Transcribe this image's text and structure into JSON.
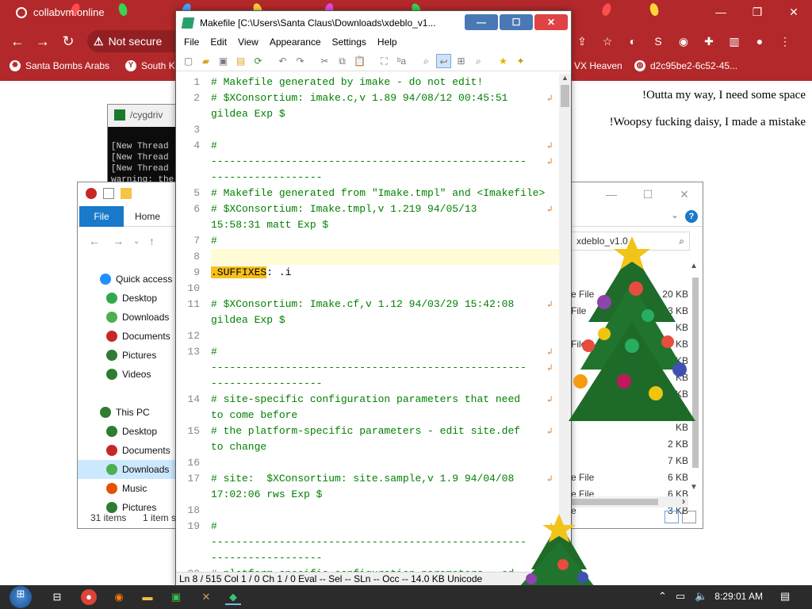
{
  "browser": {
    "tab_title": "collabvm.online",
    "security_label": "Not secure",
    "window_controls": [
      "—",
      "❐",
      "✕"
    ],
    "bookmarks": [
      {
        "icon": "bomb",
        "label": "Santa Bombs Arabs"
      },
      {
        "icon": "Y",
        "label": "South K"
      },
      {
        "icon": "globe",
        "label": "VX Heaven"
      },
      {
        "icon": "globe",
        "label": "d2c95be2-6c52-45..."
      }
    ]
  },
  "page": {
    "lines": [
      "!Outta my way, I need some space",
      "!Woopsy fucking daisy, I made a mistake"
    ]
  },
  "terminal": {
    "title": "/cygdriv",
    "lines": [
      "[New Thread",
      "[New Thread",
      "[New Thread",
      "warning: the"
    ]
  },
  "explorer": {
    "ribbon": {
      "file": "File",
      "home": "Home"
    },
    "search_placeholder": "xdeblo_v1.0",
    "nav": [
      {
        "label": "Quick access",
        "icon": "star-icon",
        "color": "#1e90ff"
      },
      {
        "label": "Desktop",
        "icon": "desktop-icon",
        "color": "#2fa84f"
      },
      {
        "label": "Downloads",
        "icon": "downloads-icon",
        "color": "#4caf50"
      },
      {
        "label": "Documents",
        "icon": "documents-icon",
        "color": "#c62828"
      },
      {
        "label": "Pictures",
        "icon": "pictures-icon",
        "color": "#2e7d32"
      },
      {
        "label": "Videos",
        "icon": "videos-icon",
        "color": "#2e7d32"
      },
      {
        "label": "",
        "icon": "",
        "color": ""
      },
      {
        "label": "This PC",
        "icon": "pc-icon",
        "color": "#2e7d32"
      },
      {
        "label": "Desktop",
        "icon": "desktop-icon",
        "color": "#2e7d32"
      },
      {
        "label": "Documents",
        "icon": "documents-icon",
        "color": "#c62828"
      },
      {
        "label": "Downloads",
        "icon": "downloads-icon",
        "color": "#4caf50"
      },
      {
        "label": "Music",
        "icon": "music-icon",
        "color": "#e65100"
      },
      {
        "label": "Pictures",
        "icon": "pictures-icon",
        "color": "#2e7d32"
      }
    ],
    "selected_nav_index": 10,
    "files": [
      {
        "type": "",
        "size": ""
      },
      {
        "type": "e File",
        "size": "20 KB"
      },
      {
        "type": "File",
        "size": "13 KB"
      },
      {
        "type": "",
        "size": "KB"
      },
      {
        "type": "File",
        "size": "KB"
      },
      {
        "type": "",
        "size": "KB"
      },
      {
        "type": "",
        "size": "KB"
      },
      {
        "type": "",
        "size": "KB"
      },
      {
        "type": "",
        "size": "KB"
      },
      {
        "type": "",
        "size": "KB"
      },
      {
        "type": "",
        "size": "2 KB"
      },
      {
        "type": "",
        "size": "7 KB"
      },
      {
        "type": "e File",
        "size": "6 KB"
      },
      {
        "type": "e File",
        "size": "6 KB"
      },
      {
        "type": "e",
        "size": "3 KB"
      }
    ],
    "status_items": "31 items",
    "status_selected": "1 item s"
  },
  "editor": {
    "title": "Makefile [C:\\Users\\Santa Claus\\Downloads\\xdeblo_v1...",
    "menu": [
      "File",
      "Edit",
      "View",
      "Appearance",
      "Settings",
      "Help"
    ],
    "lines": [
      {
        "n": "1",
        "text": "# Makefile generated by imake - do not edit!",
        "wrap": false
      },
      {
        "n": "2",
        "text": "# $XConsortium: imake.c,v 1.89 94/08/12 00:45:51",
        "wrap": true
      },
      {
        "n": "",
        "text": "gildea Exp $",
        "wrap": false
      },
      {
        "n": "3",
        "text": "",
        "wrap": false
      },
      {
        "n": "4",
        "text": "#",
        "wrap": true
      },
      {
        "n": "",
        "text": "---------------------------------------------------",
        "wrap": true
      },
      {
        "n": "",
        "text": "------------------",
        "wrap": false
      },
      {
        "n": "5",
        "text": "# Makefile generated from \"Imake.tmpl\" and <Imakefile>",
        "wrap": false
      },
      {
        "n": "6",
        "text": "# $XConsortium: Imake.tmpl,v 1.219 94/05/13",
        "wrap": true
      },
      {
        "n": "",
        "text": "15:58:31 matt Exp $",
        "wrap": false
      },
      {
        "n": "7",
        "text": "#",
        "wrap": false
      },
      {
        "n": "8",
        "text": "",
        "wrap": false
      },
      {
        "n": "9",
        "text": ": .i",
        "keyword": ".SUFFIXES",
        "wrap": false
      },
      {
        "n": "10",
        "text": "",
        "wrap": false
      },
      {
        "n": "11",
        "text": "# $XConsortium: Imake.cf,v 1.12 94/03/29 15:42:08",
        "wrap": true
      },
      {
        "n": "",
        "text": "gildea Exp $",
        "wrap": false
      },
      {
        "n": "12",
        "text": "",
        "wrap": false
      },
      {
        "n": "13",
        "text": "#",
        "wrap": true
      },
      {
        "n": "",
        "text": "---------------------------------------------------",
        "wrap": true
      },
      {
        "n": "",
        "text": "------------------",
        "wrap": false
      },
      {
        "n": "14",
        "text": "# site-specific configuration parameters that need",
        "wrap": true
      },
      {
        "n": "",
        "text": "to come before",
        "wrap": false
      },
      {
        "n": "15",
        "text": "# the platform-specific parameters - edit site.def",
        "wrap": true
      },
      {
        "n": "",
        "text": "to change",
        "wrap": false
      },
      {
        "n": "16",
        "text": "",
        "wrap": false
      },
      {
        "n": "17",
        "text": "# site:  $XConsortium: site.sample,v 1.9 94/04/08",
        "wrap": true
      },
      {
        "n": "",
        "text": "17:02:06 rws Exp $",
        "wrap": false
      },
      {
        "n": "18",
        "text": "",
        "wrap": false
      },
      {
        "n": "19",
        "text": "#",
        "wrap": true
      },
      {
        "n": "",
        "text": "---------------------------------------------------",
        "wrap": true
      },
      {
        "n": "",
        "text": "------------------",
        "wrap": false
      },
      {
        "n": "20",
        "text": "# platform-specific configuration parameters - ed",
        "wrap": false
      }
    ],
    "caret_line_index": 11,
    "status": "Ln 8 / 515   Col 1 / 0   Ch 1 / 0   Eval --   Sel --   SLn --   Occ --   14.0 KB   Unicode"
  },
  "taskbar": {
    "clock": "8:29:01 AM"
  },
  "colors": {
    "chrome_red": "#b3282a",
    "comment_green": "#008000",
    "keyword_highlight": "#f7bf1c",
    "caret_line": "#fffbd6",
    "close_red": "#e04343"
  }
}
